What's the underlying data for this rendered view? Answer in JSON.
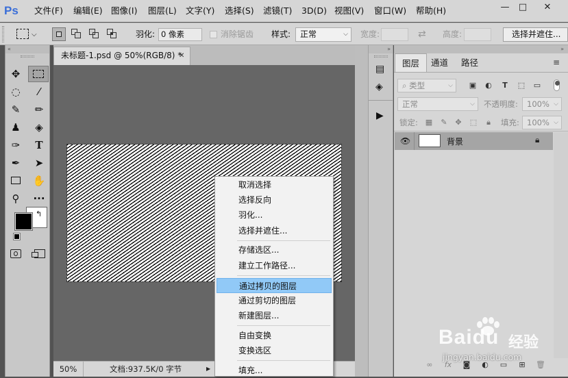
{
  "app": {
    "logo": "Ps"
  },
  "menubar": {
    "items": [
      "文件(F)",
      "编辑(E)",
      "图像(I)",
      "图层(L)",
      "文字(Y)",
      "选择(S)",
      "滤镜(T)",
      "3D(D)",
      "视图(V)",
      "窗口(W)",
      "帮助(H)"
    ]
  },
  "window_controls": {
    "minimize": "—",
    "maximize": "□",
    "close": "✕"
  },
  "options": {
    "feather_label": "羽化:",
    "feather_value": "0 像素",
    "antialias_label": "消除锯齿",
    "style_label": "样式:",
    "style_value": "正常",
    "width_label": "宽度:",
    "height_label": "高度:",
    "select_mask_button": "选择并遮住..."
  },
  "document": {
    "tab_title": "未标题-1.psd @ 50%(RGB/8) *",
    "zoom": "50%",
    "doc_info": "文档:937.5K/0 字节"
  },
  "colors": {
    "foreground": "#000000",
    "background": "#ffffff",
    "highlight": "#91c9f7"
  },
  "tools": [
    "move-icon",
    "marquee-icon",
    "lasso-icon",
    "magic-wand-icon",
    "eyedropper-icon",
    "brush-icon",
    "stamp-icon",
    "eraser-icon",
    "history-brush-icon",
    "type-icon",
    "pen-icon",
    "path-selection-icon",
    "rectangle-icon",
    "hand-icon",
    "zoom-icon",
    "more-tools-icon"
  ],
  "layers_panel": {
    "tabs": [
      "图层",
      "通道",
      "路径"
    ],
    "filter_kind": "类型",
    "blend_mode": "正常",
    "opacity_label": "不透明度:",
    "opacity_value": "100%",
    "lock_label": "锁定:",
    "fill_label": "填充:",
    "fill_value": "100%",
    "layers": [
      {
        "name": "背景",
        "visible": true,
        "locked": true
      }
    ]
  },
  "context_menu": {
    "items": [
      {
        "label": "取消选择"
      },
      {
        "label": "选择反向"
      },
      {
        "label": "羽化..."
      },
      {
        "label": "选择并遮住..."
      },
      {
        "label": "存储选区..."
      },
      {
        "label": "建立工作路径..."
      },
      {
        "label": "通过拷贝的图层",
        "highlighted": true
      },
      {
        "label": "通过剪切的图层"
      },
      {
        "label": "新建图层..."
      },
      {
        "label": "自由变换"
      },
      {
        "label": "变换选区"
      },
      {
        "label": "填充..."
      }
    ]
  },
  "watermark": {
    "brand": "Baidu",
    "cn": "经验",
    "url": "jingyan.baidu.com"
  }
}
